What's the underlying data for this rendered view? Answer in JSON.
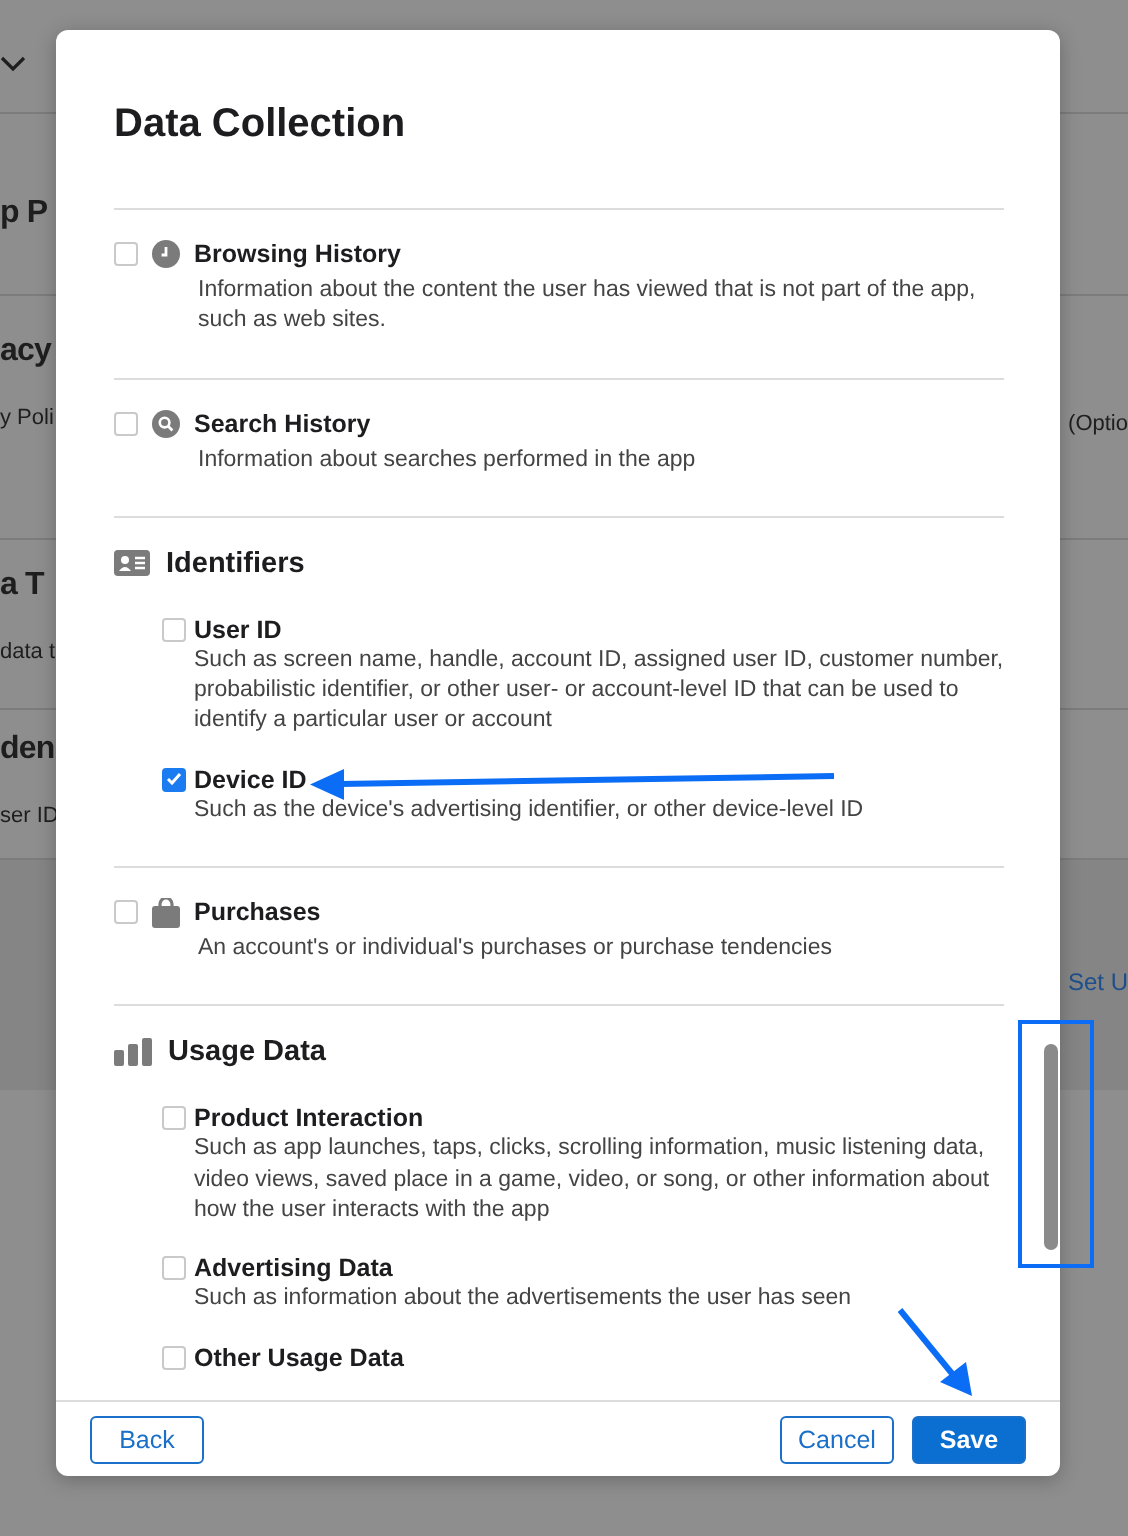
{
  "background": {
    "sections": [
      {
        "heading": "p P"
      },
      {
        "heading": "acy",
        "subtitle": "y Poli",
        "note": "(Optio"
      },
      {
        "heading": "a T",
        "subtitle": "data t"
      },
      {
        "heading": "den",
        "subtitle": "ser ID"
      },
      {
        "link": "Set U"
      }
    ]
  },
  "dialog": {
    "title": "Data Collection",
    "sections": [
      {
        "kind": "item",
        "label": "Browsing History",
        "checked": false,
        "description": "Information about the content the user has viewed that is not part of the app, such as web sites."
      },
      {
        "kind": "item",
        "label": "Search History",
        "checked": false,
        "description": "Information about searches performed in the app"
      },
      {
        "kind": "group",
        "label": "Identifiers",
        "items": [
          {
            "label": "User ID",
            "checked": false,
            "description": "Such as screen name, handle, account ID, assigned user ID, customer number, probabilistic identifier, or other user- or account-level ID that can be used to identify a particular user or account"
          },
          {
            "label": "Device ID",
            "checked": true,
            "description": "Such as the device's advertising identifier, or other device-level ID"
          }
        ]
      },
      {
        "kind": "item",
        "label": "Purchases",
        "checked": false,
        "description": "An account's or individual's purchases or purchase tendencies"
      },
      {
        "kind": "group",
        "label": "Usage Data",
        "items": [
          {
            "label": "Product Interaction",
            "checked": false,
            "description": "Such as app launches, taps, clicks, scrolling information, music listening data, video views, saved place in a game, video, or song, or other information about how the user interacts with the app"
          },
          {
            "label": "Advertising Data",
            "checked": false,
            "description": "Such as information about the advertisements the user has seen"
          },
          {
            "label": "Other Usage Data",
            "checked": false
          }
        ]
      }
    ],
    "buttons": [
      {
        "label": "Back",
        "kind": "secondary"
      },
      {
        "label": "Cancel",
        "kind": "secondary"
      },
      {
        "label": "Save",
        "kind": "primary"
      }
    ]
  }
}
